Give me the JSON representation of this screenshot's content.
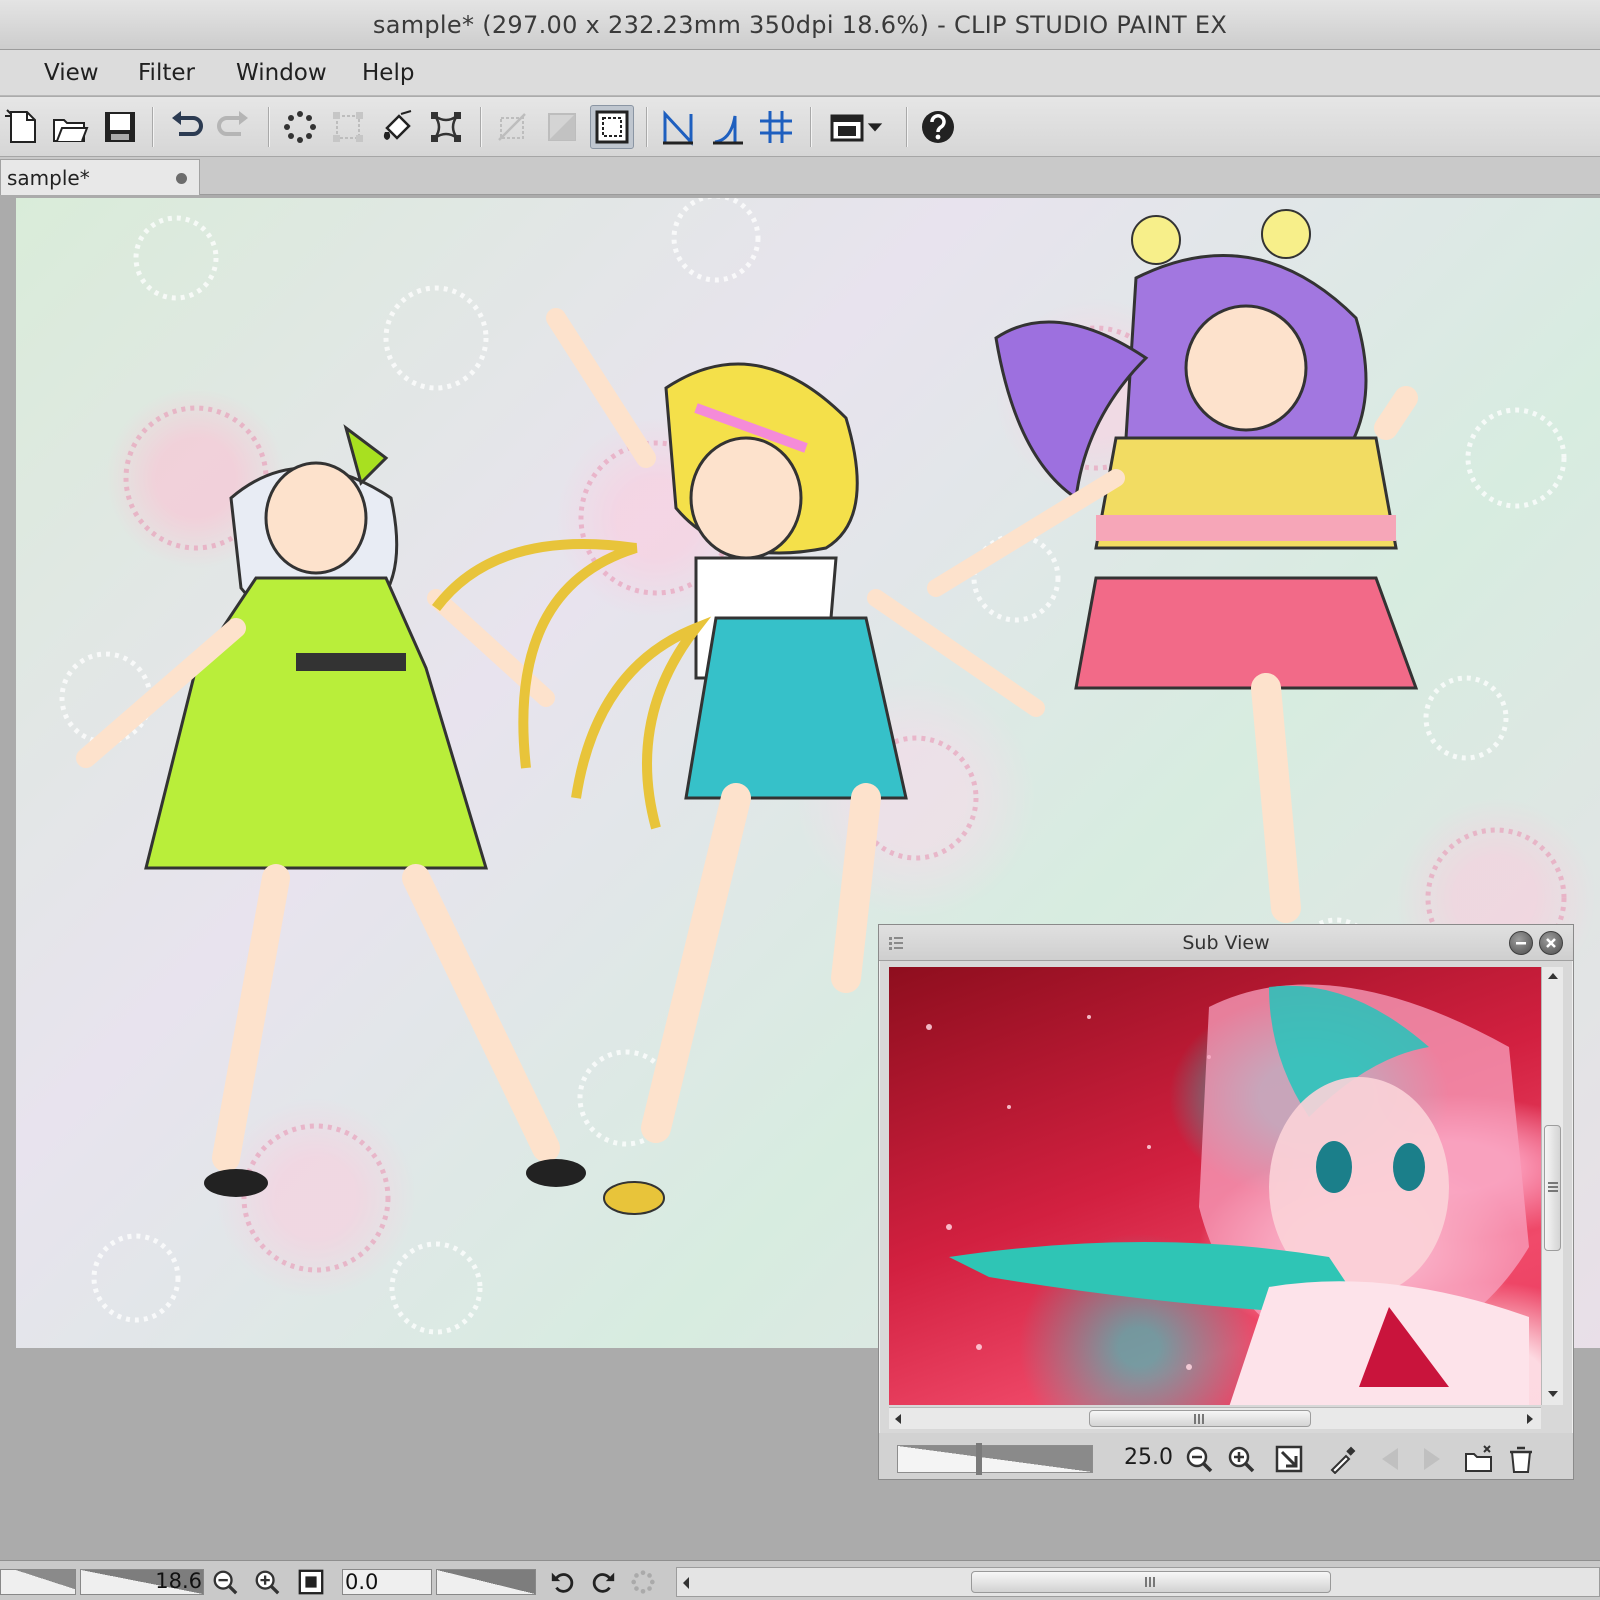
{
  "window": {
    "title": "sample* (297.00 x 232.23mm 350dpi 18.6%)  - CLIP STUDIO PAINT EX"
  },
  "menu": {
    "items": [
      "View",
      "Filter",
      "Window",
      "Help"
    ]
  },
  "toolbar": {
    "icons": [
      "new-file-icon",
      "open-folder-icon",
      "save-icon",
      "undo-icon",
      "redo-icon",
      "selection-launcher-icon",
      "transform-icon",
      "fill-icon",
      "mesh-transform-icon",
      "crop-icon",
      "clear-outside-icon",
      "show-selection-area-icon",
      "ruler-snap-icon",
      "special-ruler-snap-icon",
      "grid-snap-icon",
      "screen-mode-icon",
      "help-icon"
    ],
    "active_icon": "show-selection-area-icon"
  },
  "tabs": {
    "document": "sample*"
  },
  "canvas": {
    "description_colors": [
      "#d9ecd9",
      "#e8e3ee"
    ]
  },
  "subview": {
    "title": "Sub View",
    "zoom": "25.0",
    "tools": [
      "zoom-out-icon",
      "zoom-in-icon",
      "fit-icon",
      "eyedropper-icon",
      "previous-image-icon",
      "next-image-icon",
      "import-image-icon",
      "clear-image-icon"
    ]
  },
  "statusbar": {
    "zoom": "18.6",
    "rotation": "0.0"
  }
}
